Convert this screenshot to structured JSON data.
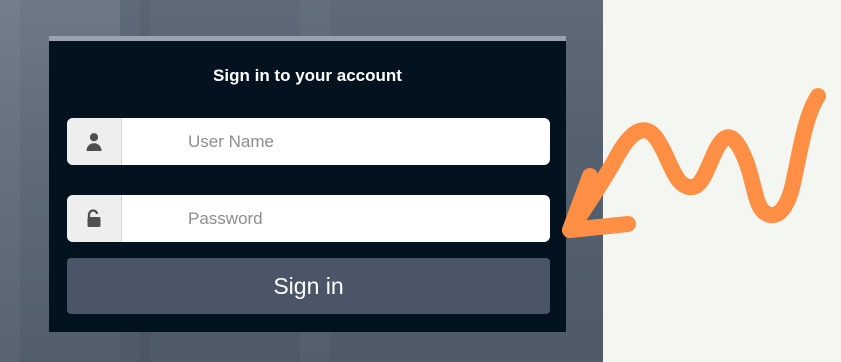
{
  "login": {
    "title": "Sign in to your account",
    "username": {
      "placeholder": "User Name",
      "value": "",
      "icon": "user-icon"
    },
    "password": {
      "placeholder": "Password",
      "value": "",
      "icon": "unlock-icon"
    },
    "submit_label": "Sign in"
  },
  "theme": {
    "page_background": "#f4f6f2",
    "backdrop": "#56616f",
    "panel": "#02131f",
    "button": "#4a5667",
    "arrow": "#ff8f45"
  }
}
